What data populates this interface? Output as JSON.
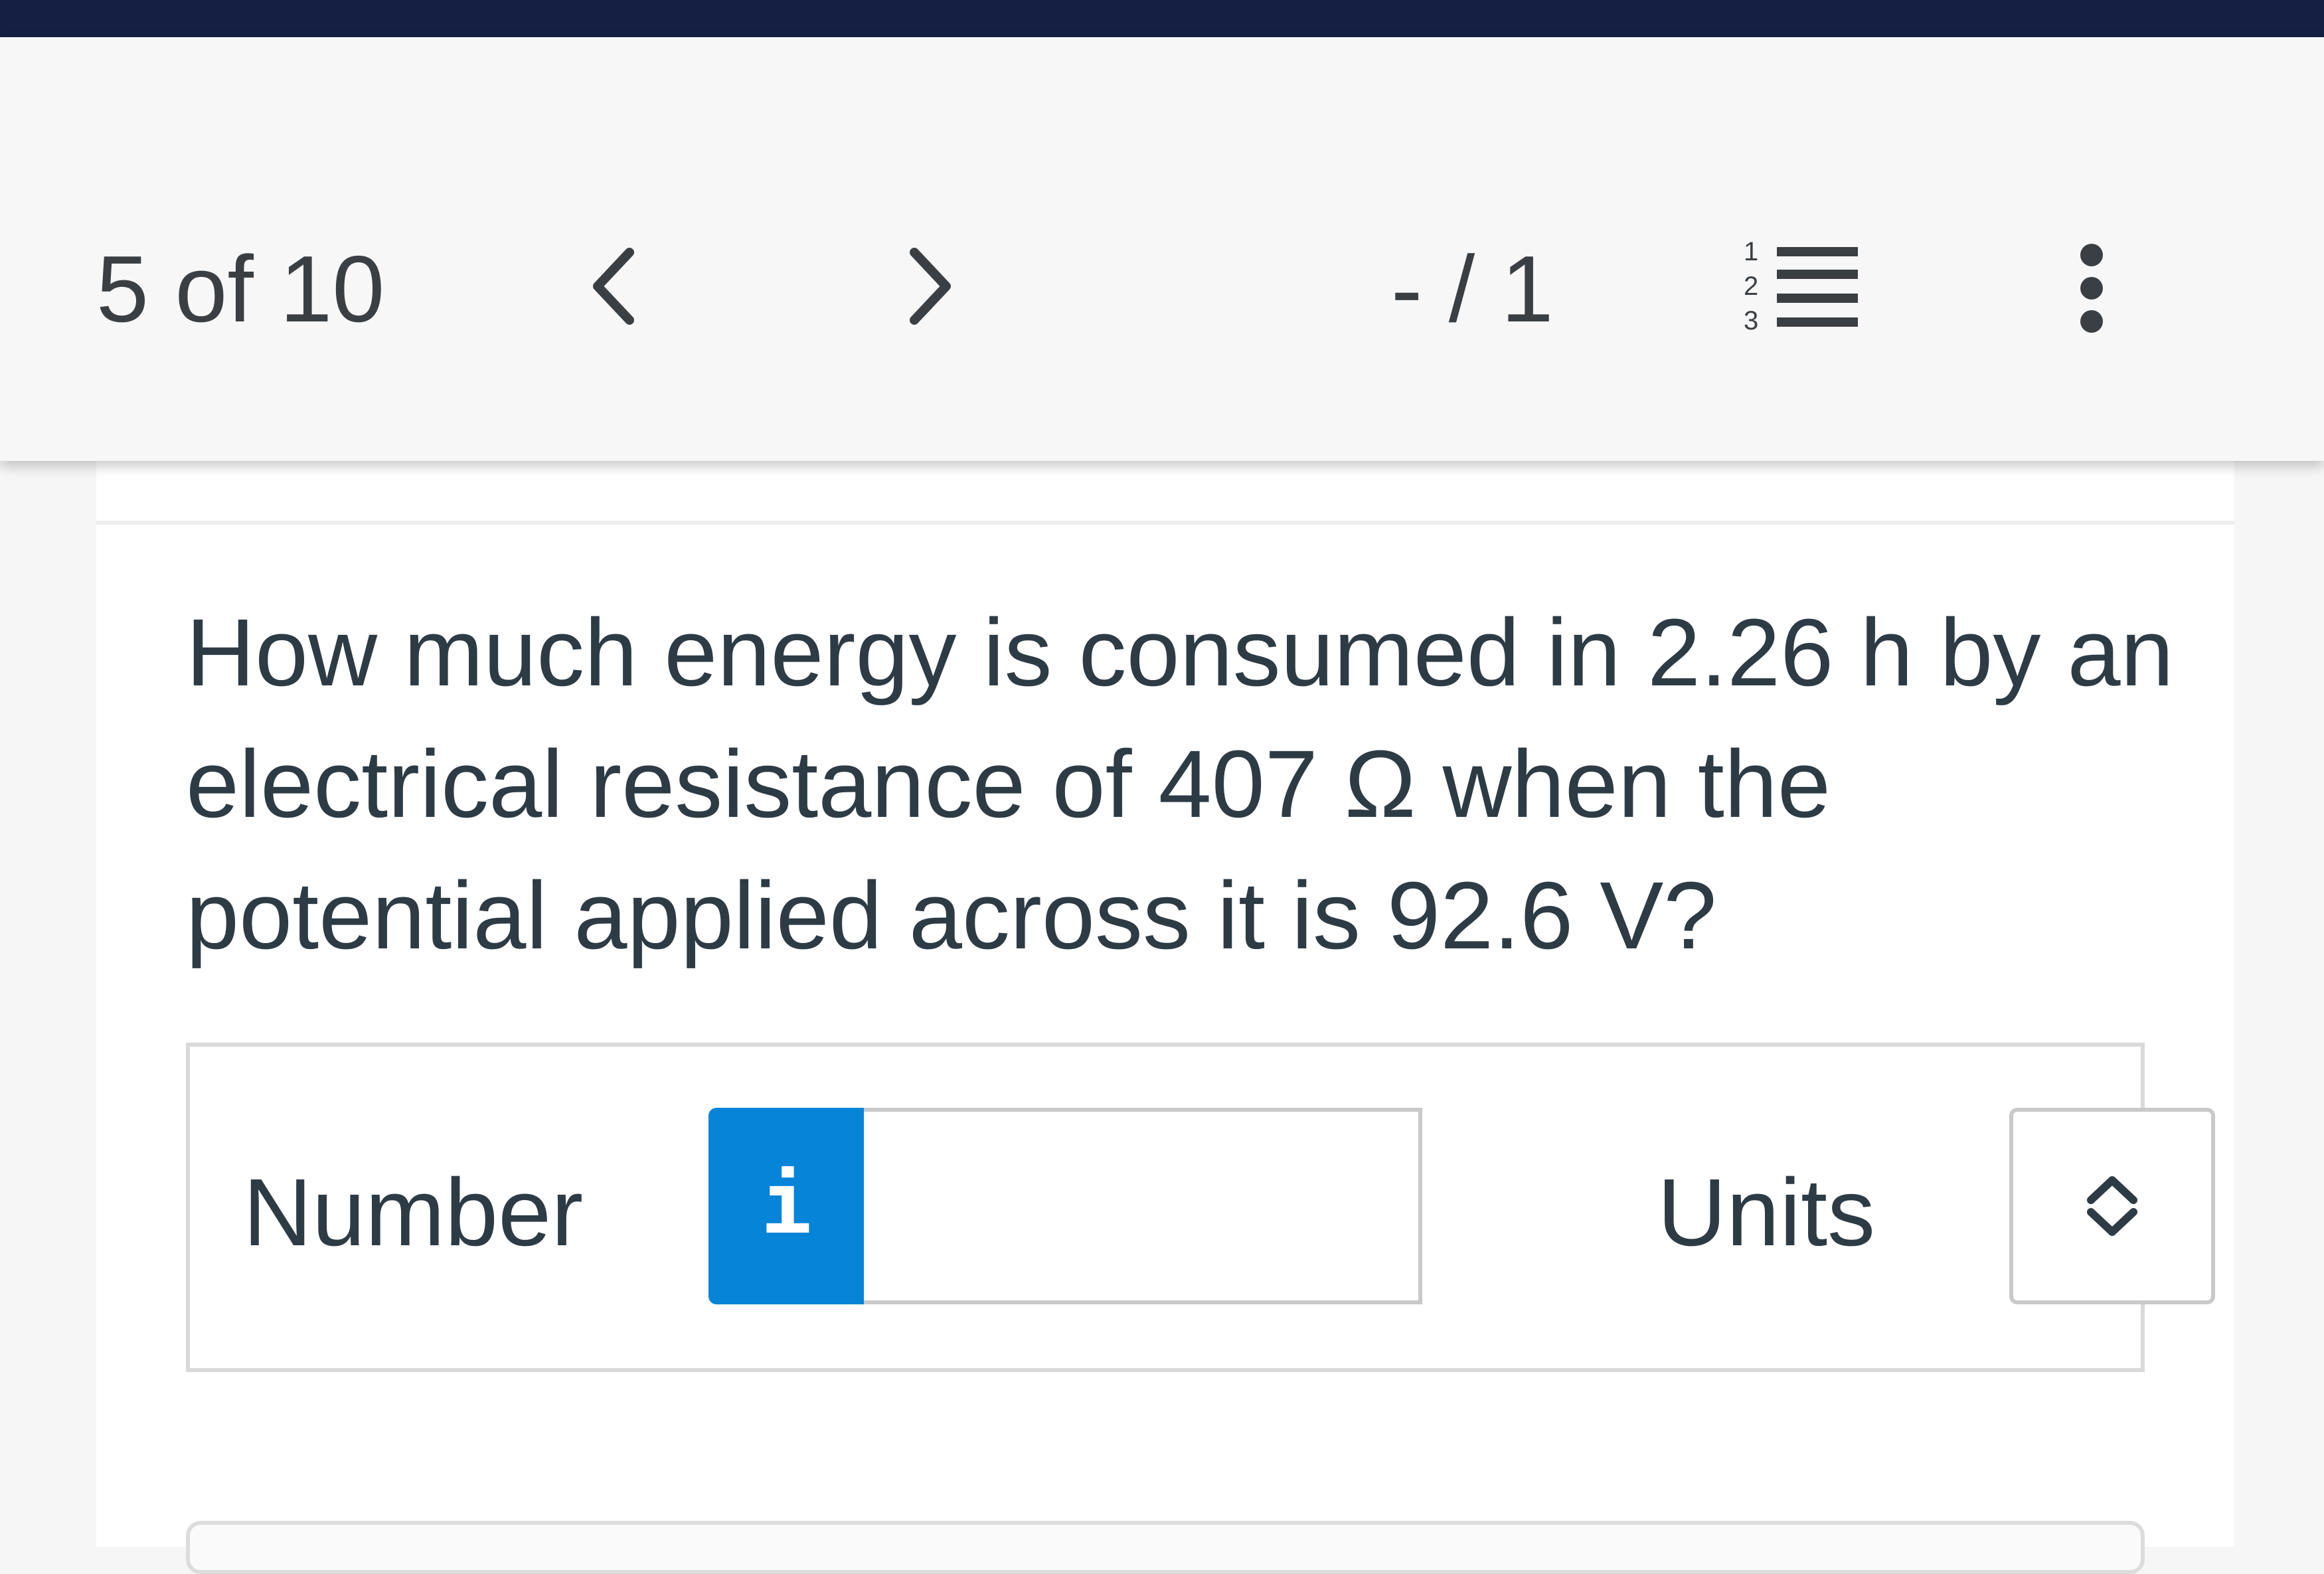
{
  "colors": {
    "top_bar": "#141f43",
    "header_bg": "#f7f7f7",
    "text": "#2d3b45",
    "info_button": "#0684d8"
  },
  "header": {
    "progress": "5 of 10",
    "prev_icon": "chevron-left-icon",
    "next_icon": "chevron-right-icon",
    "score": "- / 1",
    "list_icon": "numbered-list-icon",
    "list_digits": [
      "1",
      "2",
      "3"
    ],
    "more_icon": "more-vertical-icon"
  },
  "question": {
    "text": "How much energy is consumed in 2.26 h by an electrical resistance of 407 Ω when the potential applied across it is 92.6 V?"
  },
  "answer": {
    "number_label": "Number",
    "info_icon": "info-icon",
    "info_glyph": "i",
    "number_value": "",
    "units_label": "Units",
    "units_icon": "up-down-chevron-icon",
    "units_value": ""
  }
}
